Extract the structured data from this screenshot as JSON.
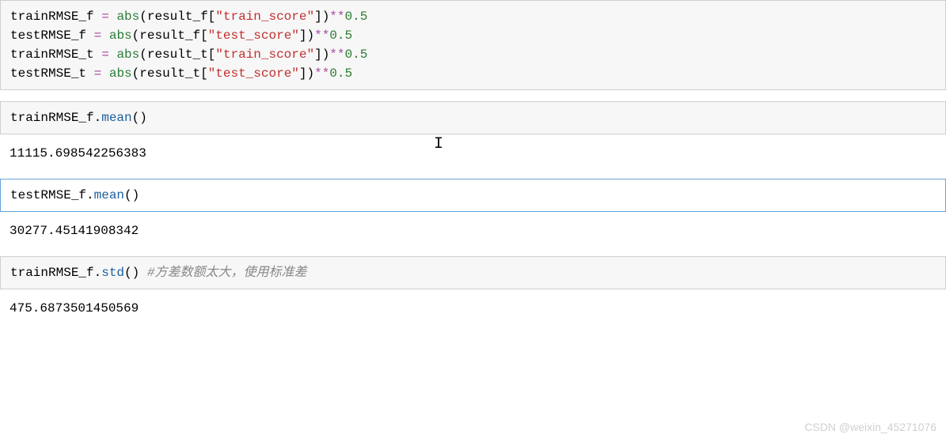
{
  "cells": [
    {
      "type": "code",
      "selected": false,
      "lines": [
        {
          "parts": [
            {
              "t": "trainRMSE_f ",
              "c": "var"
            },
            {
              "t": "=",
              "c": "op"
            },
            {
              "t": " ",
              "c": "var"
            },
            {
              "t": "abs",
              "c": "builtin"
            },
            {
              "t": "(result_f[",
              "c": "var"
            },
            {
              "t": "\"train_score\"",
              "c": "string"
            },
            {
              "t": "])",
              "c": "var"
            },
            {
              "t": "**",
              "c": "op"
            },
            {
              "t": "0.5",
              "c": "num"
            }
          ]
        },
        {
          "parts": [
            {
              "t": "testRMSE_f ",
              "c": "var"
            },
            {
              "t": "=",
              "c": "op"
            },
            {
              "t": " ",
              "c": "var"
            },
            {
              "t": "abs",
              "c": "builtin"
            },
            {
              "t": "(result_f[",
              "c": "var"
            },
            {
              "t": "\"test_score\"",
              "c": "string"
            },
            {
              "t": "])",
              "c": "var"
            },
            {
              "t": "**",
              "c": "op"
            },
            {
              "t": "0.5",
              "c": "num"
            }
          ]
        },
        {
          "parts": [
            {
              "t": "trainRMSE_t ",
              "c": "var"
            },
            {
              "t": "=",
              "c": "op"
            },
            {
              "t": " ",
              "c": "var"
            },
            {
              "t": "abs",
              "c": "builtin"
            },
            {
              "t": "(result_t[",
              "c": "var"
            },
            {
              "t": "\"train_score\"",
              "c": "string"
            },
            {
              "t": "])",
              "c": "var"
            },
            {
              "t": "**",
              "c": "op"
            },
            {
              "t": "0.5",
              "c": "num"
            }
          ]
        },
        {
          "parts": [
            {
              "t": "testRMSE_t ",
              "c": "var"
            },
            {
              "t": "=",
              "c": "op"
            },
            {
              "t": " ",
              "c": "var"
            },
            {
              "t": "abs",
              "c": "builtin"
            },
            {
              "t": "(result_t[",
              "c": "var"
            },
            {
              "t": "\"test_score\"",
              "c": "string"
            },
            {
              "t": "])",
              "c": "var"
            },
            {
              "t": "**",
              "c": "op"
            },
            {
              "t": "0.5",
              "c": "num"
            }
          ]
        }
      ],
      "output": null
    },
    {
      "type": "code",
      "selected": false,
      "lines": [
        {
          "parts": [
            {
              "t": "trainRMSE_f.",
              "c": "var"
            },
            {
              "t": "mean",
              "c": "method"
            },
            {
              "t": "()",
              "c": "var"
            }
          ]
        }
      ],
      "output": "11115.698542256383"
    },
    {
      "type": "code",
      "selected": true,
      "lines": [
        {
          "parts": [
            {
              "t": "testRMSE_f.",
              "c": "var"
            },
            {
              "t": "mean",
              "c": "method"
            },
            {
              "t": "()",
              "c": "var"
            }
          ]
        }
      ],
      "output": "30277.45141908342"
    },
    {
      "type": "code",
      "selected": false,
      "lines": [
        {
          "parts": [
            {
              "t": "trainRMSE_f.",
              "c": "var"
            },
            {
              "t": "std",
              "c": "method"
            },
            {
              "t": "() ",
              "c": "var"
            },
            {
              "t": "#方差数额太大，使用标准差",
              "c": "comment"
            }
          ]
        }
      ],
      "output": "475.6873501450569"
    }
  ],
  "watermark": "CSDN @weixin_45271076",
  "cursor_glyph": "I"
}
